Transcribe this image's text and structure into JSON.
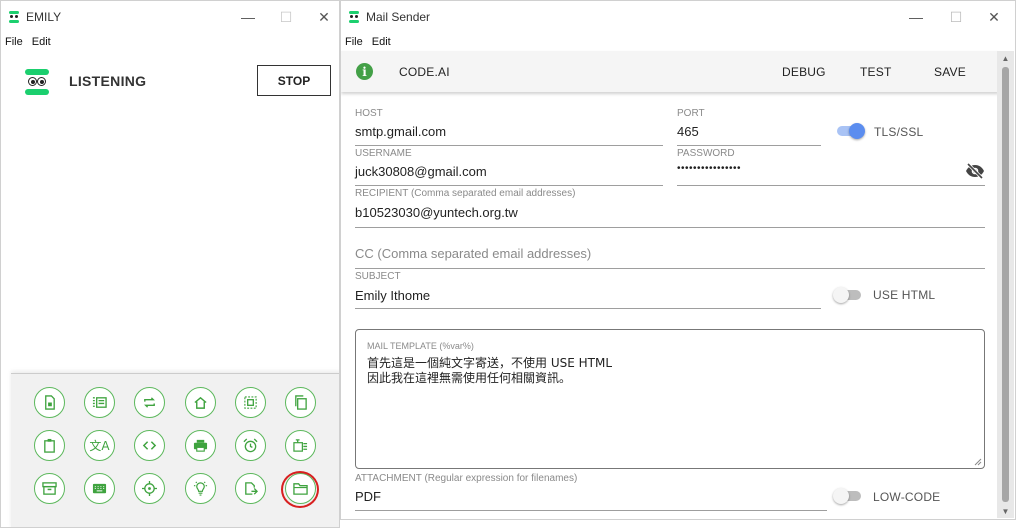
{
  "emily": {
    "title": "EMILY",
    "menu": [
      "File",
      "Edit"
    ],
    "status": "LISTENING",
    "stop_label": "STOP",
    "icon_buttons": [
      "page-icon",
      "list-icon",
      "repeat-icon",
      "home-icon",
      "select-icon",
      "copy-icon",
      "clipboard-icon",
      "translate-icon",
      "code-icon",
      "print-icon",
      "alarm-icon",
      "text-fields-icon",
      "archive-icon",
      "keyboard-icon",
      "crosshair-icon",
      "lightbulb-icon",
      "file-export-icon",
      "folder-open-icon"
    ]
  },
  "mail": {
    "title": "Mail Sender",
    "menu": [
      "File",
      "Edit"
    ],
    "toolbar": {
      "app_label": "CODE.AI",
      "debug": "DEBUG",
      "test": "TEST",
      "save": "SAVE"
    },
    "host": {
      "label": "HOST",
      "value": "smtp.gmail.com"
    },
    "port": {
      "label": "PORT",
      "value": "465"
    },
    "tls": {
      "label": "TLS/SSL",
      "on": true
    },
    "username": {
      "label": "USERNAME",
      "value": "juck30808@gmail.com"
    },
    "password": {
      "label": "PASSWORD",
      "value": "••••••••••••••••"
    },
    "recipient": {
      "label": "RECIPIENT (Comma separated email addresses)",
      "value": "b10523030@yuntech.org.tw"
    },
    "cc": {
      "placeholder": "CC (Comma separated email addresses)"
    },
    "subject": {
      "label": "SUBJECT",
      "value": "Emily Ithome"
    },
    "use_html": {
      "label": "USE HTML",
      "on": false
    },
    "template": {
      "label": "MAIL TEMPLATE (%var%)",
      "value": "首先這是一個純文字寄送，不使用 USE HTML\n因此我在這裡無需使用任何相關資訊。"
    },
    "attachment": {
      "label": "ATTACHMENT (Regular expression for filenames)",
      "value": "PDF"
    },
    "low_code": {
      "label": "LOW-CODE",
      "on": false
    }
  },
  "colors": {
    "accent_green": "#1bcf6e",
    "button_green": "#3fa33f",
    "toggle_on": "#5b8def",
    "highlight_red": "#d82020"
  }
}
